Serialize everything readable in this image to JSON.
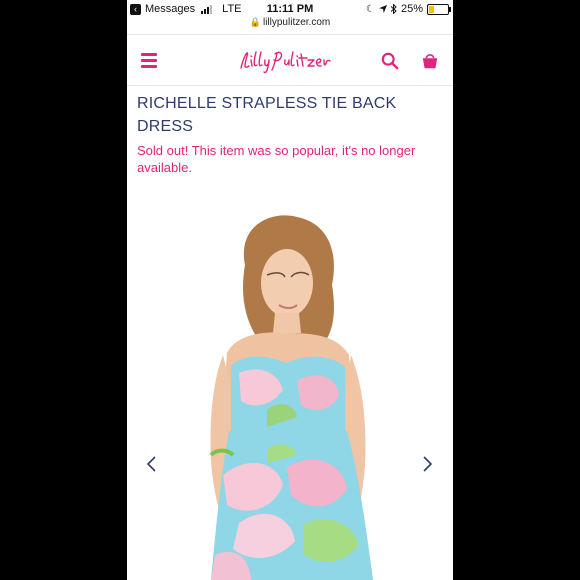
{
  "status_bar": {
    "back_app": "Messages",
    "network": "LTE",
    "time": "11:11 PM",
    "battery": "25%",
    "battery_level": 0.25
  },
  "browser": {
    "url": "lillypulitzer.com"
  },
  "header": {
    "logo_text": "Lilly Pulitzer",
    "menu_icon": "hamburger-menu-icon",
    "search_icon": "search-icon",
    "bag_icon": "shopping-bag-icon"
  },
  "product": {
    "name": "RICHELLE STRAPLESS TIE BACK DRESS",
    "availability": "Sold out! This item was so popular, it's no longer available."
  },
  "gallery": {
    "prev_icon": "chevron-left-icon",
    "next_icon": "chevron-right-icon"
  },
  "colors": {
    "brand_pink": "#e0247c",
    "title_navy": "#2d3b6e"
  }
}
